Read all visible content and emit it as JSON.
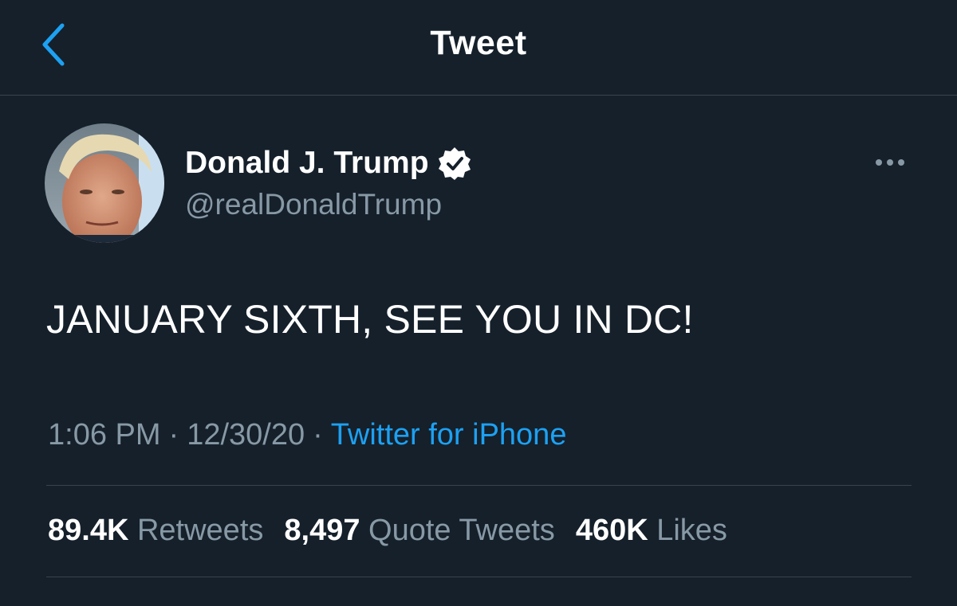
{
  "header": {
    "title": "Tweet",
    "back_icon": "chevron-left-icon"
  },
  "colors": {
    "background": "#15202b",
    "accent": "#1da1f2",
    "secondary_text": "#8899a6",
    "divider": "#38444d"
  },
  "tweet": {
    "author": {
      "display_name": "Donald J. Trump",
      "handle": "@realDonaldTrump",
      "verified": true,
      "verified_icon": "verified-badge-icon",
      "avatar_icon": "avatar-photo"
    },
    "more_icon": "more-options-icon",
    "text": "JANUARY SIXTH, SEE YOU IN DC!",
    "meta": {
      "time": "1:06 PM",
      "separator": "·",
      "date": "12/30/20",
      "source": "Twitter for iPhone"
    },
    "stats": [
      {
        "count": "89.4K",
        "label": "Retweets"
      },
      {
        "count": "8,497",
        "label": "Quote Tweets"
      },
      {
        "count": "460K",
        "label": "Likes"
      }
    ]
  }
}
